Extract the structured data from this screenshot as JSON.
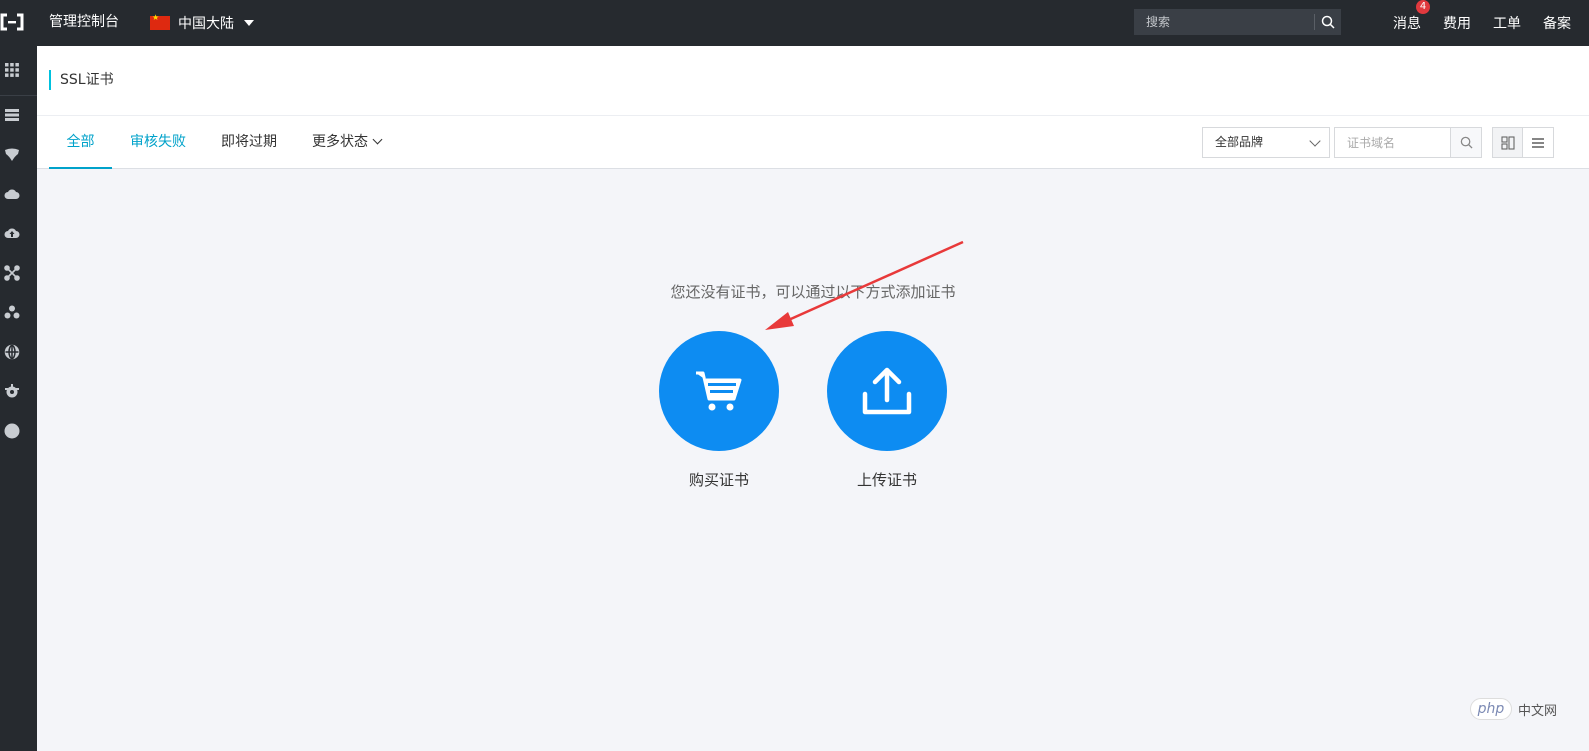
{
  "topbar": {
    "brand": "管理控制台",
    "region": "中国大陆",
    "search_placeholder": "搜索",
    "nav": [
      {
        "label": "消息",
        "badge": "4"
      },
      {
        "label": "费用"
      },
      {
        "label": "工单"
      },
      {
        "label": "备案"
      }
    ]
  },
  "page": {
    "title": "SSL证书",
    "tabs": [
      {
        "label": "全部",
        "state": "active"
      },
      {
        "label": "审核失败",
        "state": "highlight"
      },
      {
        "label": "即将过期"
      },
      {
        "label": "更多状态"
      }
    ],
    "brand_filter": "全部品牌",
    "domain_search_placeholder": "证书域名"
  },
  "empty_state": {
    "message": "您还没有证书，可以通过以下方式添加证书",
    "actions": [
      {
        "label": "购买证书",
        "icon": "cart-icon"
      },
      {
        "label": "上传证书",
        "icon": "upload-icon"
      }
    ]
  },
  "colors": {
    "accent": "#00a2ca",
    "action_blue": "#0d8cf2",
    "topbar": "#262a2f",
    "annotation_arrow": "#e8393a"
  },
  "watermark": {
    "logo": "php",
    "text": "中文网"
  }
}
